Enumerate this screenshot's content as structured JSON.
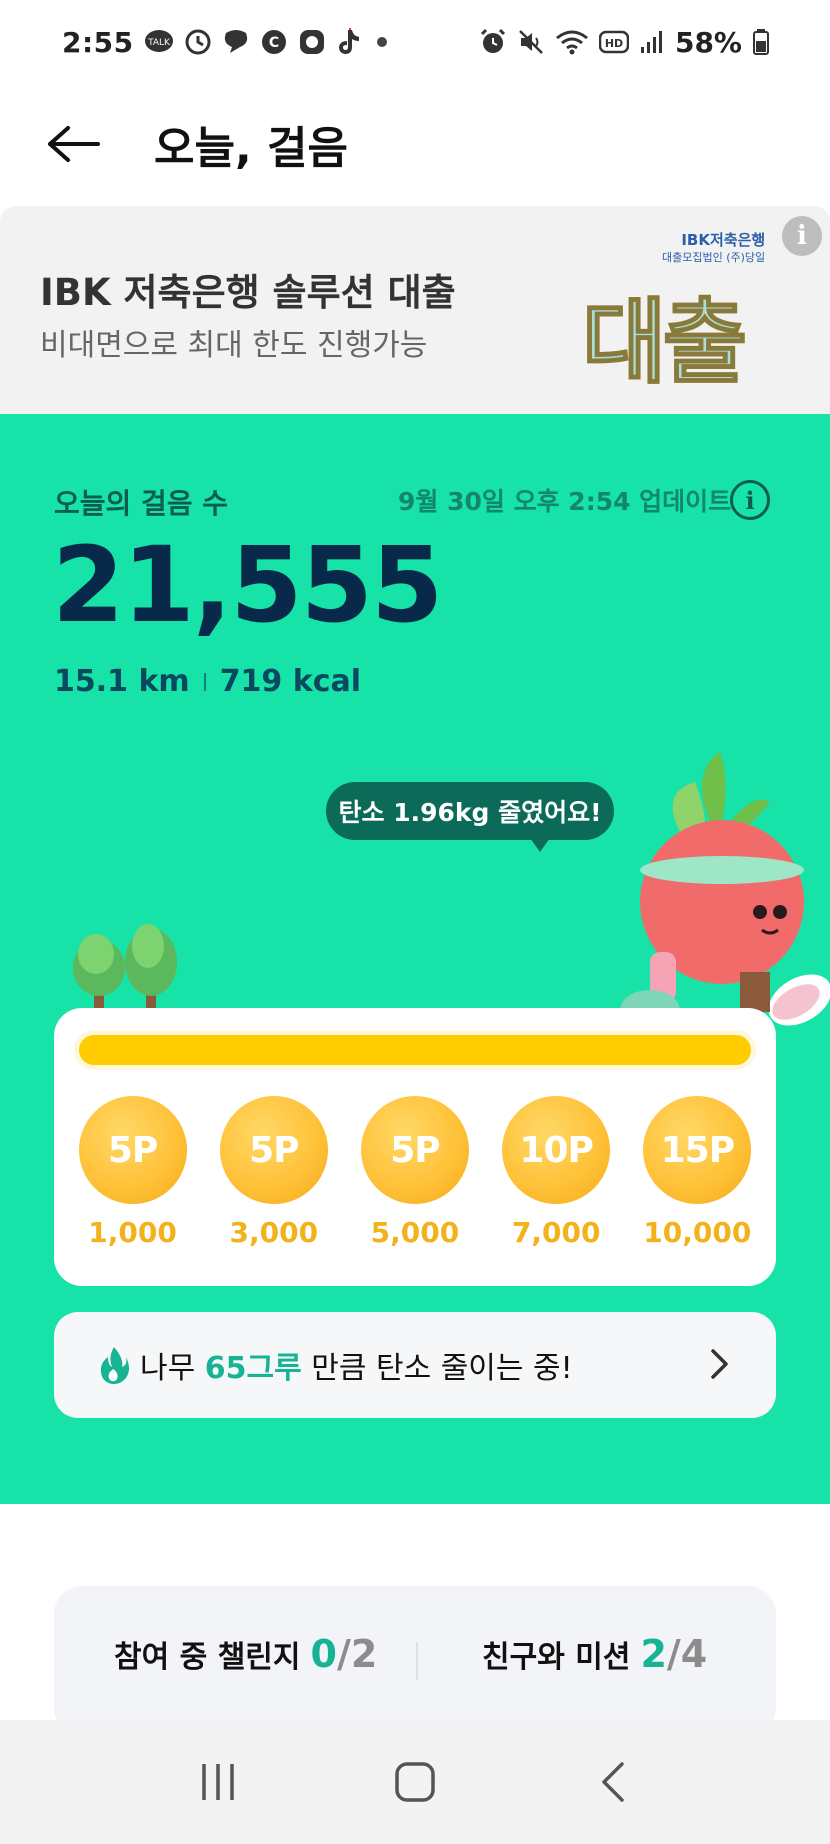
{
  "status_bar": {
    "time": "2:55",
    "battery": "58%",
    "left_icons": [
      "kakaotalk-icon",
      "timer-icon",
      "chat-icon",
      "c-icon",
      "app-icon",
      "tiktok-icon",
      "dot-icon"
    ],
    "right_icons": [
      "alarm-icon",
      "mute-icon",
      "wifi-icon",
      "hd-icon",
      "signal-icon",
      "battery-icon"
    ],
    "kakao_badge": "TALK"
  },
  "header": {
    "title": "오늘, 걸음",
    "back_icon": "arrow-left-icon"
  },
  "ad": {
    "title": "IBK 저축은행 솔루션 대출",
    "subtitle": "비대면으로 최대 한도 진행가능",
    "brand": "IBK저축은행",
    "brand_sub": "대출모집법인 (주)당일",
    "big_text": "대출",
    "info_icon": "i"
  },
  "steps": {
    "label": "오늘의 걸음 수",
    "updated": "9월 30일 오후 2:54 업데이트",
    "info_icon": "i",
    "count": "21,555",
    "distance": "15.1 km",
    "calories": "719 kcal",
    "bubble": "탄소 1.96kg 줄였어요!"
  },
  "rewards": {
    "progress": 1.0,
    "items": [
      {
        "points": "5P",
        "steps": "1,000"
      },
      {
        "points": "5P",
        "steps": "3,000"
      },
      {
        "points": "5P",
        "steps": "5,000"
      },
      {
        "points": "10P",
        "steps": "7,000"
      },
      {
        "points": "15P",
        "steps": "10,000"
      }
    ]
  },
  "carbon": {
    "prefix": "나무 ",
    "highlight": "65그루",
    "suffix": " 만큼 탄소 줄이는 중!"
  },
  "challenges": {
    "joined_label": "참여 중 챌린지",
    "joined_current": "0",
    "joined_total": "/2",
    "mission_label": "친구와 미션",
    "mission_current": "2",
    "mission_total": "/4"
  },
  "colors": {
    "green_bg": "#17e2a7",
    "accent": "#16b394",
    "coin": "#ffc23a",
    "progress": "#ffcc00"
  }
}
